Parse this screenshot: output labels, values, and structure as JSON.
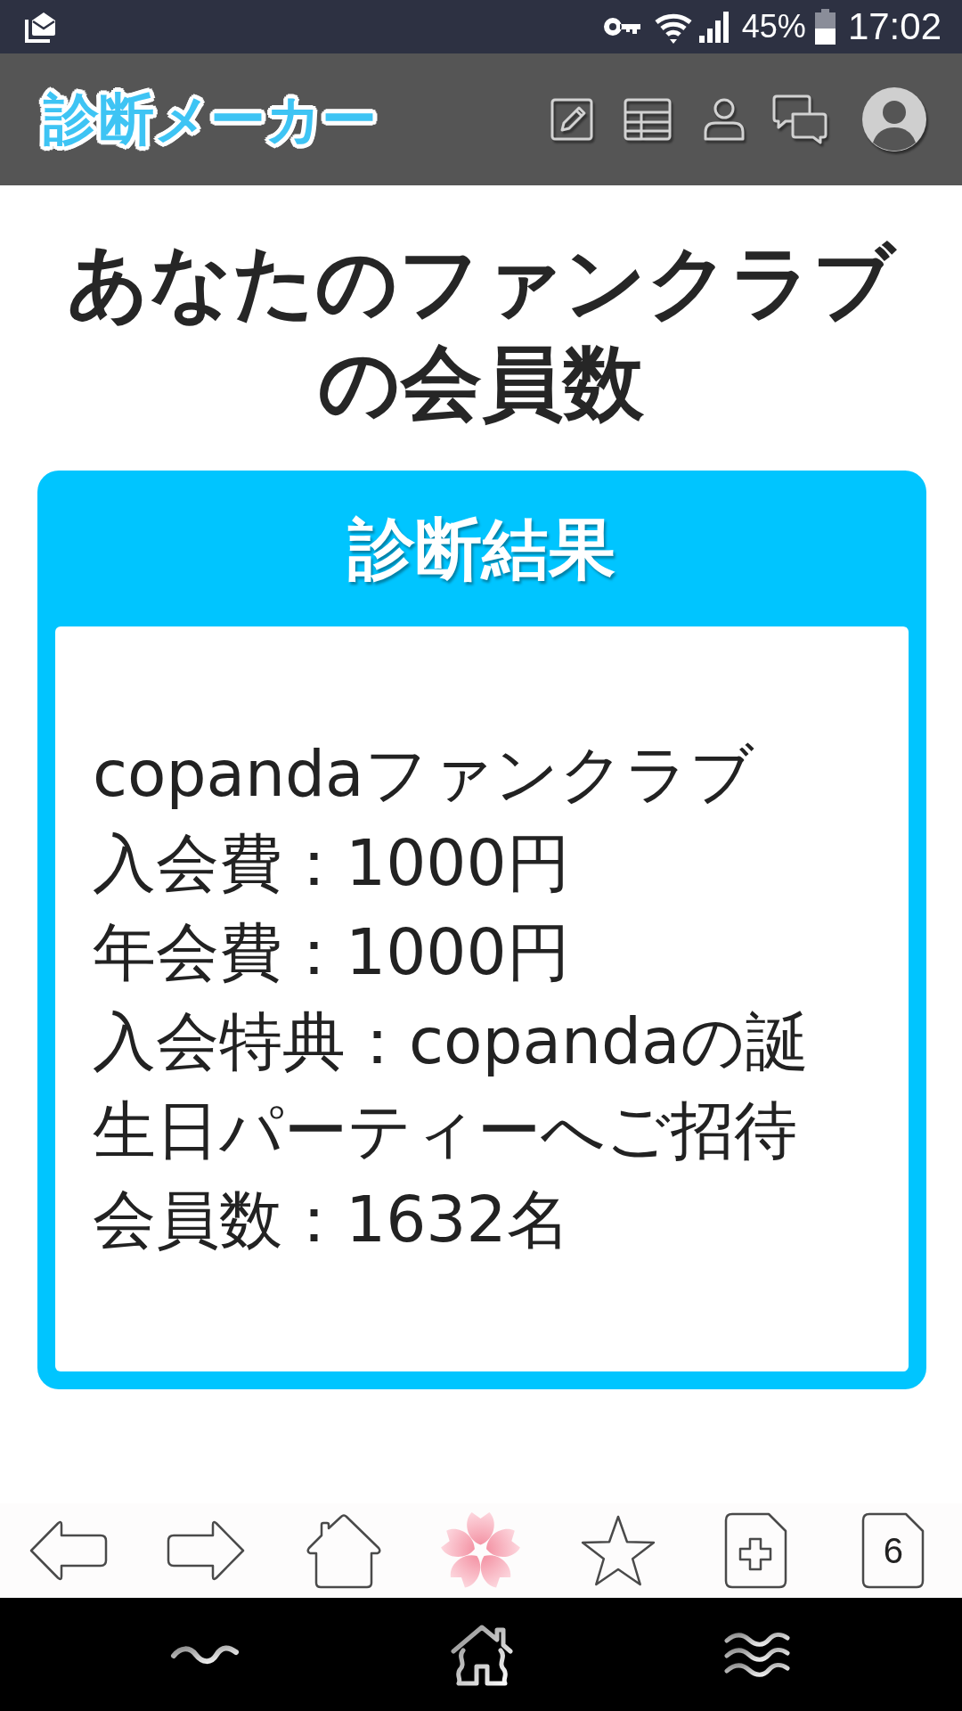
{
  "status_bar": {
    "battery": "45%",
    "time": "17:02"
  },
  "app_bar": {
    "logo": "診断メーカー"
  },
  "title": "あなたのファンクラブの会員数",
  "result_card": {
    "heading": "診断結果",
    "lines": [
      "copandaファンクラブ",
      "入会費：1000円",
      "年会費：1000円",
      "入会特典：copandaの誕生日パーティーへご招待",
      "会員数：1632名"
    ]
  },
  "browser_toolbar": {
    "tab_count": "6"
  }
}
